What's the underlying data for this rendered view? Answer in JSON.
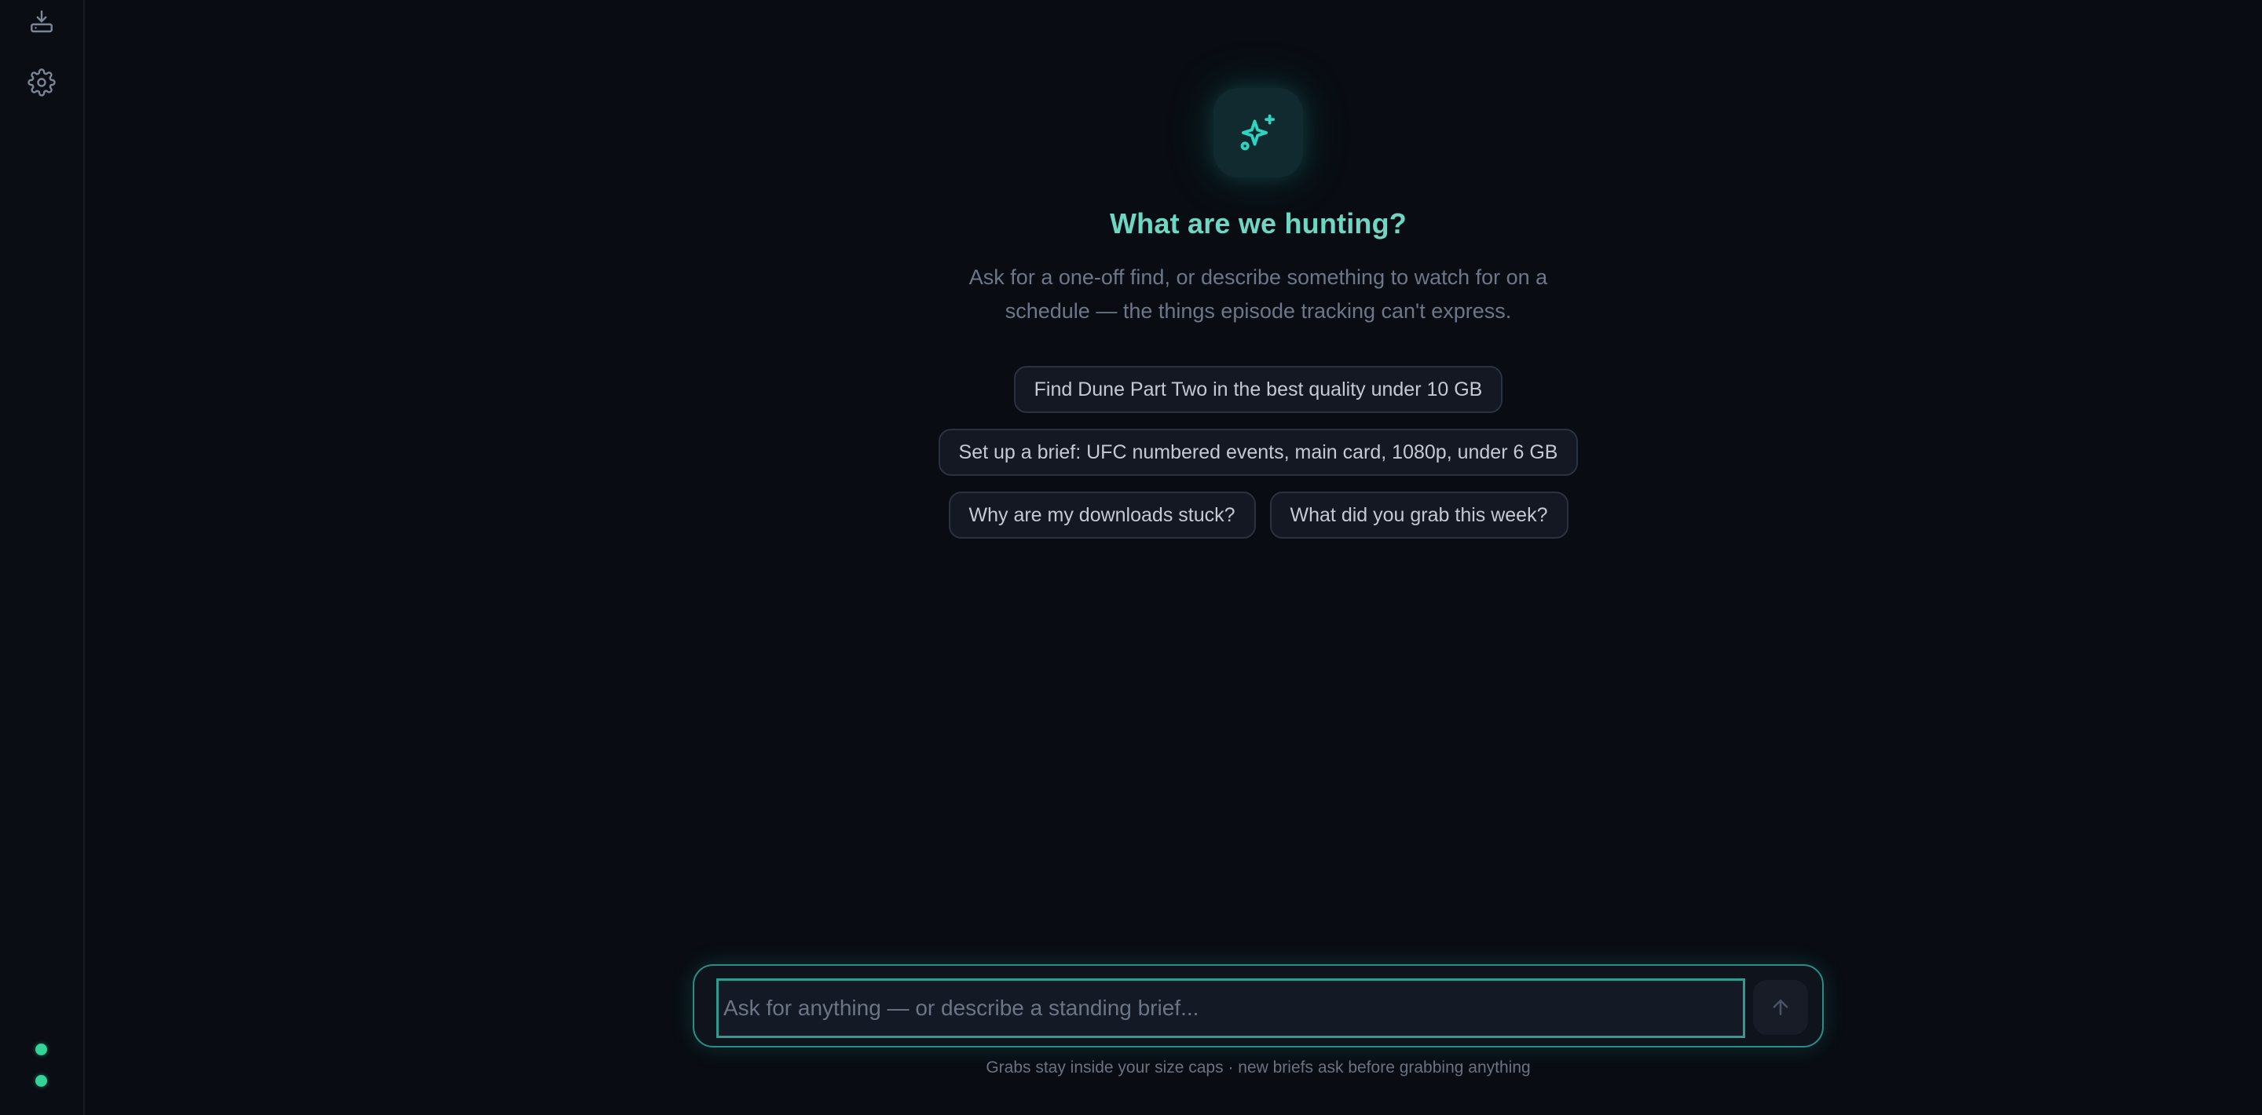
{
  "sidebar": {
    "items": [
      {
        "name": "downloads",
        "icon": "tray-download-icon"
      },
      {
        "name": "settings",
        "icon": "gear-icon"
      }
    ],
    "status_indicators": [
      {
        "color": "#34d399"
      },
      {
        "color": "#34d399"
      }
    ]
  },
  "hero": {
    "icon": "sparkles-icon",
    "title": "What are we hunting?",
    "subtitle": "Ask for a one-off find, or describe something to watch for on a schedule — the things episode tracking can't express."
  },
  "suggestions": [
    "Find Dune Part Two in the best quality under 10 GB",
    "Set up a brief: UFC numbered events, main card, 1080p, under 6 GB",
    "Why are my downloads stuck?",
    "What did you grab this week?"
  ],
  "composer": {
    "value": "",
    "placeholder": "Ask for anything — or describe a standing brief...",
    "send_icon": "arrow-up-icon"
  },
  "footnote": "Grabs stay inside your size caps · new briefs ask before grabbing anything",
  "colors": {
    "background": "#090c13",
    "accent": "#2dd4bf",
    "headline": "#6fd6c2",
    "status": "#34d399"
  }
}
